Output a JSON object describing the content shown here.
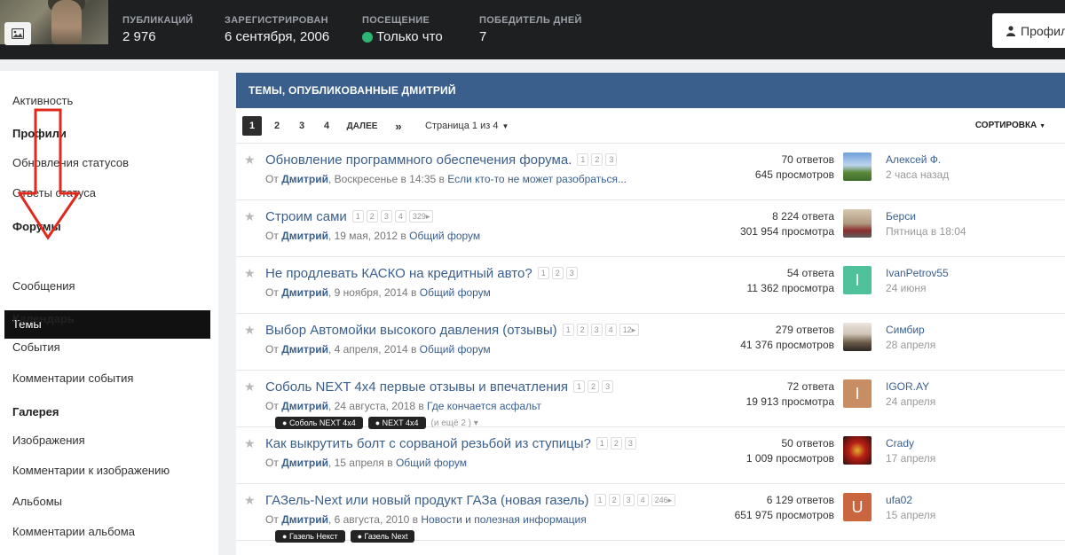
{
  "header": {
    "stats": [
      {
        "label": "ПУБЛИКАЦИЙ",
        "value": "2 976"
      },
      {
        "label": "ЗАРЕГИСТРИРОВАН",
        "value": "6 сентября, 2006"
      },
      {
        "label": "ПОСЕЩЕНИЕ",
        "value": "Только что"
      },
      {
        "label": "ПОБЕДИТЕЛЬ ДНЕЙ",
        "value": "7"
      }
    ],
    "profile_button": "Профил",
    "online_color": "#2bb673"
  },
  "sidebar": {
    "activity": "Активность",
    "sections": [
      {
        "heading": "Профили",
        "items": [
          "Обновления статусов",
          "Ответы статуса"
        ]
      },
      {
        "heading": "Форумы",
        "items": [
          "Темы",
          "Сообщения"
        ]
      },
      {
        "heading": "Календарь",
        "items": [
          "События",
          "Комментарии события"
        ]
      },
      {
        "heading": "Галерея",
        "items": [
          "Изображения",
          "Комментарии к изображению",
          "Альбомы",
          "Комментарии альбома"
        ]
      }
    ],
    "active_item": "Темы"
  },
  "main": {
    "title": "ТЕМЫ, ОПУБЛИКОВАННЫЕ ДМИТРИЙ",
    "pagination": {
      "pages": [
        "1",
        "2",
        "3",
        "4"
      ],
      "next": "ДАЛЕЕ",
      "last": "»",
      "page_of": "Страница 1 из 4",
      "sort": "СОРТИРОВКА"
    },
    "topics": [
      {
        "title": "Обновление программного обеспечения форума.",
        "pages": [
          "1",
          "2",
          "3"
        ],
        "by": "От",
        "author": "Дмитрий",
        "date": ", Воскресенье в 14:35 в ",
        "forum": "Если кто-то не может разобраться...",
        "replies": "70 ответов",
        "views": "645 просмотров",
        "last_user": "Алексей Ф.",
        "last_time": "2 часа назад",
        "avatar_letter": "",
        "tags": []
      },
      {
        "title": "Строим сами",
        "pages": [
          "1",
          "2",
          "3",
          "4",
          "329"
        ],
        "by": "От",
        "author": "Дмитрий",
        "date": ", 19 мая, 2012 в ",
        "forum": "Общий форум",
        "replies": "8 224 ответа",
        "views": "301 954 просмотра",
        "last_user": "Берси",
        "last_time": "Пятница в 18:04",
        "avatar_letter": "",
        "tags": []
      },
      {
        "title": "Не продлевать КАСКО на кредитный авто?",
        "pages": [
          "1",
          "2",
          "3"
        ],
        "by": "От",
        "author": "Дмитрий",
        "date": ", 9 ноября, 2014 в ",
        "forum": "Общий форум",
        "replies": "54 ответа",
        "views": "11 362 просмотра",
        "last_user": "IvanPetrov55",
        "last_time": "24 июня",
        "avatar_letter": "I",
        "tags": []
      },
      {
        "title": "Выбор Автомойки высокого давления (отзывы)",
        "pages": [
          "1",
          "2",
          "3",
          "4",
          "12"
        ],
        "by": "От",
        "author": "Дмитрий",
        "date": ", 4 апреля, 2014 в ",
        "forum": "Общий форум",
        "replies": "279 ответов",
        "views": "41 376 просмотров",
        "last_user": "Симбир",
        "last_time": "28 апреля",
        "avatar_letter": "",
        "tags": []
      },
      {
        "title": "Соболь NEXT 4x4 первые отзывы и впечатления",
        "pages": [
          "1",
          "2",
          "3"
        ],
        "by": "От",
        "author": "Дмитрий",
        "date": ", 24 августа, 2018 в ",
        "forum": "Где кончается асфальт",
        "replies": "72 ответа",
        "views": "19 913 просмотра",
        "last_user": "IGOR.AY",
        "last_time": "24 апреля",
        "avatar_letter": "I",
        "tags": [
          "Соболь NEXT 4x4",
          "NEXT 4x4"
        ],
        "tags_more": "(и ещё 2 )"
      },
      {
        "title": "Как выкрутить болт с сорваной резьбой из ступицы?",
        "pages": [
          "1",
          "2",
          "3"
        ],
        "by": "От",
        "author": "Дмитрий",
        "date": ", 15 апреля в ",
        "forum": "Общий форум",
        "replies": "50 ответов",
        "views": "1 009 просмотров",
        "last_user": "Crady",
        "last_time": "17 апреля",
        "avatar_letter": "",
        "tags": []
      },
      {
        "title": "ГАЗель-Next или новый продукт ГАЗа (новая газель)",
        "pages": [
          "1",
          "2",
          "3",
          "4",
          "246"
        ],
        "by": "От",
        "author": "Дмитрий",
        "date": ", 6 августа, 2010 в ",
        "forum": "Новости и полезная информация",
        "replies": "6 129 ответов",
        "views": "651 975 просмотров",
        "last_user": "ufa02",
        "last_time": "15 апреля",
        "avatar_letter": "U",
        "tags": [
          "Газель Некст",
          "Газель Next"
        ]
      }
    ]
  }
}
